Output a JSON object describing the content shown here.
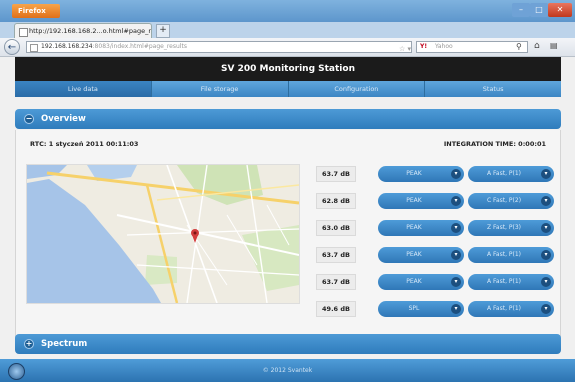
{
  "browser": {
    "app_button_label": "Firefox",
    "tab_title": "http://192.168.168.2...o.html#page_results",
    "new_tab_label": "+",
    "url_main": "192.168.168.234",
    "url_rest": ":8083/index.html#page_results",
    "search_engine": "Y!",
    "search_placeholder": "Yahoo",
    "back_icon": "back-arrow-icon",
    "home_icon": "home-icon",
    "bookmark_icon": "star-icon",
    "window_controls": [
      "–",
      "□",
      "✕"
    ]
  },
  "site": {
    "title": "SV 200 Monitoring Station",
    "nav": [
      "Live data",
      "File storage",
      "Configuration",
      "Status"
    ],
    "active_nav": 0
  },
  "overview": {
    "heading": "Overview",
    "toggle": "−",
    "rtc": "RTC: 1 styczeń 2011 00:11:03",
    "integration_time": "INTEGRATION TIME: 0:00:01",
    "rows": [
      {
        "value": "63.7 dB",
        "mode": "PEAK",
        "weighting": "A Fast, P(1)"
      },
      {
        "value": "62.8 dB",
        "mode": "PEAK",
        "weighting": "C Fast, P(2)"
      },
      {
        "value": "63.0 dB",
        "mode": "PEAK",
        "weighting": "Z Fast, P(3)"
      },
      {
        "value": "63.7 dB",
        "mode": "PEAK",
        "weighting": "A Fast, P(1)"
      },
      {
        "value": "63.7 dB",
        "mode": "PEAK",
        "weighting": "A Fast, P(1)"
      },
      {
        "value": "49.6 dB",
        "mode": "SPL",
        "weighting": "A Fast, P(1)"
      }
    ]
  },
  "spectrum": {
    "heading": "Spectrum",
    "toggle": "+"
  },
  "footer": {
    "text": "© 2012 Svantek"
  },
  "colors": {
    "accent": "#3c86c4",
    "header_bg": "#1b1b1b",
    "map_water": "#a6c4e8",
    "map_pin": "#d23c3c"
  }
}
